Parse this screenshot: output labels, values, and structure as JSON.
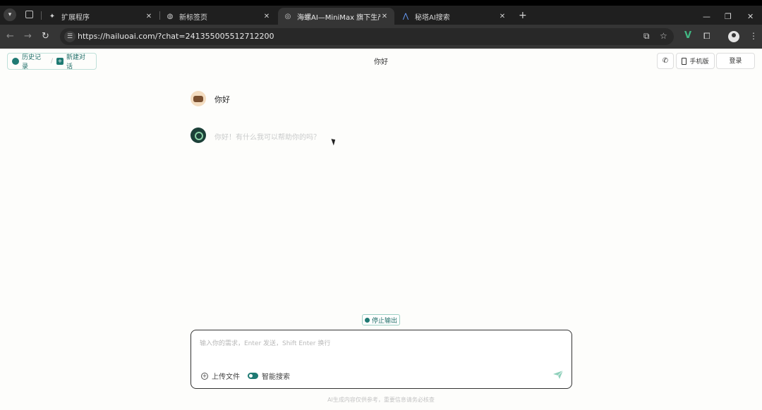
{
  "browser": {
    "tabs": [
      {
        "label": "扩展程序",
        "icon": "puzzle-icon"
      },
      {
        "label": "新标签页",
        "icon": "globe-icon"
      },
      {
        "label": "海螺AI—MiniMax 旗下生产力",
        "icon": "hailuo-icon",
        "active": true
      },
      {
        "label": "秘塔AI搜索",
        "icon": "metaso-icon"
      }
    ],
    "url": "https://hailuoai.com/?chat=241355005512712200"
  },
  "header": {
    "history_label": "历史记录",
    "new_chat_label": "新建对话",
    "title": "你好",
    "mobile_label": "手机版",
    "login_label": "登录"
  },
  "conversation": {
    "user_message": "你好",
    "bot_message": "你好！有什么我可以帮助你的吗？"
  },
  "composer": {
    "stop_label": "停止输出",
    "placeholder": "输入你的需求，Enter 发送，Shift Enter 换行",
    "upload_label": "上传文件",
    "smart_search_label": "智能搜索",
    "smart_search_on": true
  },
  "footer": {
    "note": "AI生成内容仅供参考，重要信息请务必核查"
  }
}
